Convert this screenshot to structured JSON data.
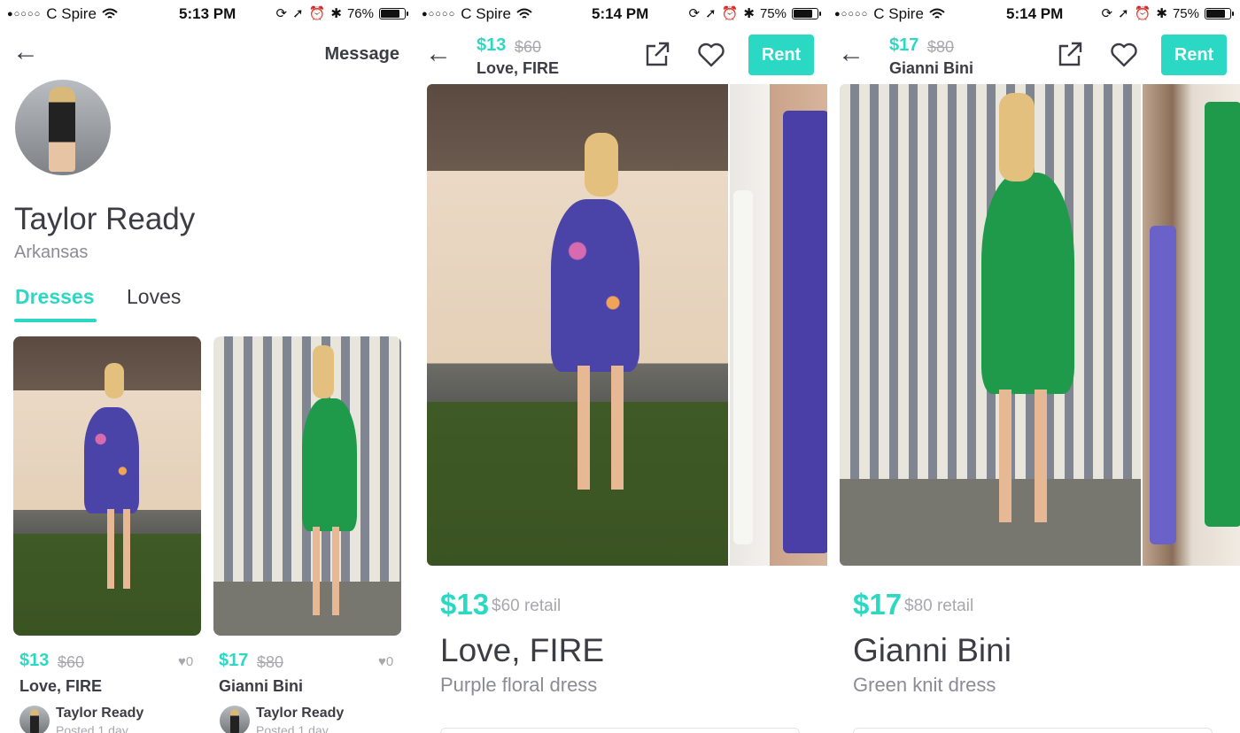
{
  "profile_screen": {
    "status": {
      "carrier": "C Spire",
      "time": "5:13 PM",
      "battery": "76%"
    },
    "message_label": "Message",
    "name": "Taylor Ready",
    "location": "Arkansas",
    "tabs": [
      "Dresses",
      "Loves"
    ],
    "cards": [
      {
        "price": "$13",
        "retail": "$60",
        "likes": "0",
        "title": "Love, FIRE",
        "owner": "Taylor Ready",
        "posted": "Posted 1 day"
      },
      {
        "price": "$17",
        "retail": "$80",
        "likes": "0",
        "title": "Gianni Bini",
        "owner": "Taylor Ready",
        "posted": "Posted 1 day"
      }
    ]
  },
  "detail_screens": [
    {
      "status": {
        "carrier": "C Spire",
        "time": "5:14 PM",
        "battery": "75%"
      },
      "header_price": "$13",
      "header_retail": "$60",
      "header_title": "Love, FIRE",
      "rent_label": "Rent",
      "price": "$13",
      "retail_text": "$60 retail",
      "title": "Love, FIRE",
      "subtitle": "Purple floral dress"
    },
    {
      "status": {
        "carrier": "C Spire",
        "time": "5:14 PM",
        "battery": "75%"
      },
      "header_price": "$17",
      "header_retail": "$80",
      "header_title": "Gianni Bini",
      "rent_label": "Rent",
      "price": "$17",
      "retail_text": "$80 retail",
      "title": "Gianni Bini",
      "subtitle": "Green knit dress"
    }
  ],
  "icons": [
    "back-arrow-icon",
    "wifi-icon",
    "location-icon",
    "alarm-icon",
    "bluetooth-icon",
    "lock-rotation-icon",
    "share-icon",
    "heart-icon"
  ],
  "colors": {
    "accent": "#2ad8c4",
    "text": "#3c3c44",
    "muted": "#a7a7ad"
  }
}
